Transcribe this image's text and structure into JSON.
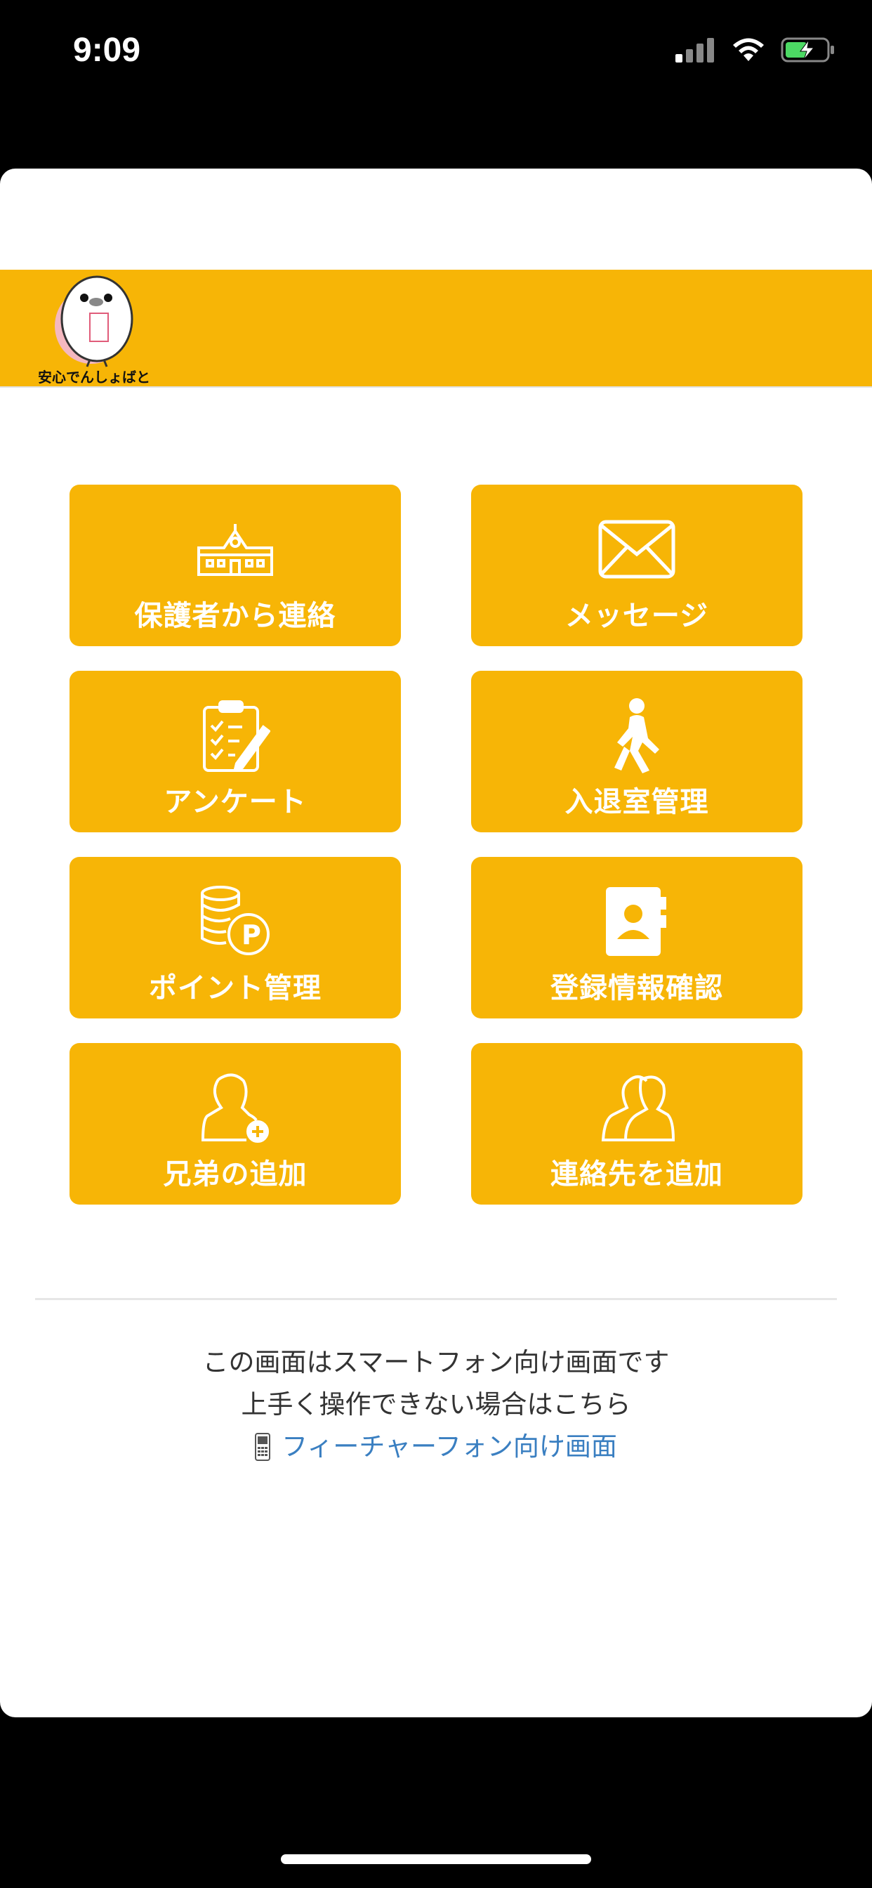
{
  "status_bar": {
    "time": "9:09",
    "icons": [
      "signal-icon",
      "wifi-icon",
      "battery-charging-icon"
    ]
  },
  "header": {
    "logo_text": "安心でんしょばと",
    "background_color": "#F7B506"
  },
  "menu": {
    "tile_color": "#F7B506",
    "items": [
      {
        "label": "保護者から連絡",
        "icon": "school-icon"
      },
      {
        "label": "メッセージ",
        "icon": "envelope-icon"
      },
      {
        "label": "アンケート",
        "icon": "clipboard-icon"
      },
      {
        "label": "入退室管理",
        "icon": "walking-person-icon"
      },
      {
        "label": "ポイント管理",
        "icon": "coins-point-icon"
      },
      {
        "label": "登録情報確認",
        "icon": "contact-book-icon"
      },
      {
        "label": "兄弟の追加",
        "icon": "add-person-icon"
      },
      {
        "label": "連絡先を追加",
        "icon": "people-icon"
      }
    ]
  },
  "footer": {
    "line1": "この画面はスマートフォン向け画面です",
    "line2": "上手く操作できない場合はこちら",
    "link_label": "フィーチャーフォン向け画面",
    "link_icon": "feature-phone-icon",
    "link_color": "#3a7fc1"
  }
}
